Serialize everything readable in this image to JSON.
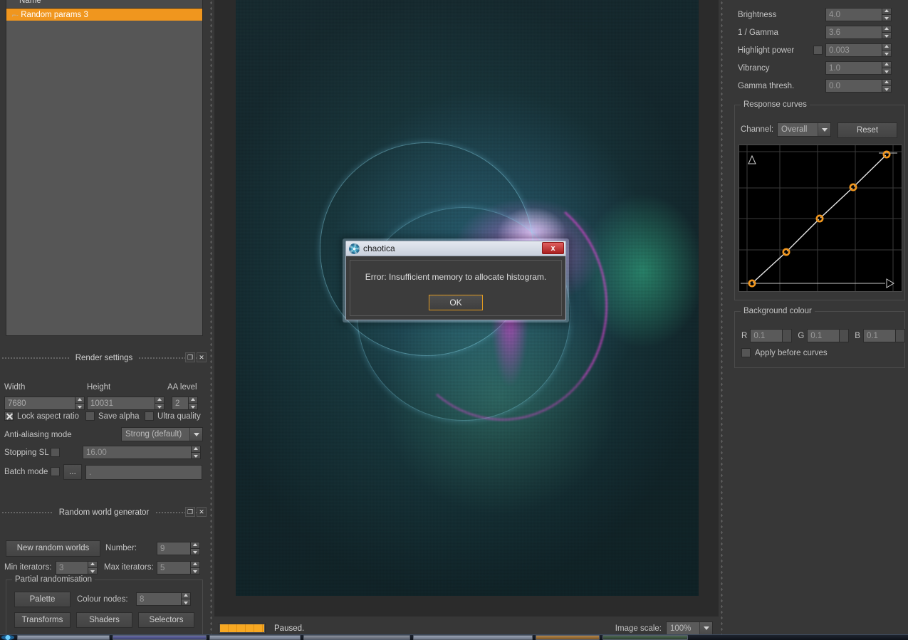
{
  "world_list": {
    "header": "Name",
    "items": [
      {
        "label": "Random params 3",
        "selected": true
      }
    ]
  },
  "render_settings": {
    "title": "Render settings",
    "float_icon": "restore-icon",
    "close_icon": "close-icon",
    "width_label": "Width",
    "width_value": "7680",
    "height_label": "Height",
    "height_value": "10031",
    "aa_level_label": "AA level",
    "aa_level_value": "2",
    "lock_aspect_label": "Lock aspect ratio",
    "lock_aspect_checked": true,
    "save_alpha_label": "Save alpha",
    "save_alpha_checked": false,
    "ultra_quality_label": "Ultra quality",
    "ultra_quality_checked": false,
    "aa_mode_label": "Anti-aliasing mode",
    "aa_mode_value": "Strong (default)",
    "stopping_sl_label": "Stopping SL",
    "stopping_sl_checked": false,
    "stopping_sl_value": "16.00",
    "batch_mode_label": "Batch mode",
    "batch_mode_checked": false,
    "batch_browse_label": "...",
    "batch_path_value": "."
  },
  "random_world_generator": {
    "title": "Random world generator",
    "new_worlds_label": "New random worlds",
    "number_label": "Number:",
    "number_value": "9",
    "min_iterators_label": "Min iterators:",
    "min_iterators_value": "3",
    "max_iterators_label": "Max iterators:",
    "max_iterators_value": "5",
    "partial_randomisation": {
      "title": "Partial randomisation",
      "palette_label": "Palette",
      "colour_nodes_label": "Colour nodes:",
      "colour_nodes_value": "8",
      "transforms_label": "Transforms",
      "shaders_label": "Shaders",
      "selectors_label": "Selectors"
    }
  },
  "image_settings": {
    "brightness_label": "Brightness",
    "brightness_value": "4.0",
    "inv_gamma_label": "1 / Gamma",
    "inv_gamma_value": "3.6",
    "highlight_power_label": "Highlight power",
    "highlight_power_checked": false,
    "highlight_power_value": "0.003",
    "vibrancy_label": "Vibrancy",
    "vibrancy_value": "1.0",
    "gamma_thresh_label": "Gamma thresh.",
    "gamma_thresh_value": "0.0"
  },
  "response_curves": {
    "title": "Response curves",
    "channel_label": "Channel:",
    "channel_value": "Overall",
    "reset_label": "Reset",
    "node_color": "#f0961e",
    "curve_color": "#e6e6e6"
  },
  "background_colour": {
    "title": "Background colour",
    "r_label": "R",
    "r_value": "0.1",
    "g_label": "G",
    "g_value": "0.1",
    "b_label": "B",
    "b_value": "0.1",
    "apply_before_curves_label": "Apply before curves",
    "apply_before_curves_checked": false
  },
  "status_bar": {
    "status_text": "Paused.",
    "progress_color": "#f7a822",
    "image_scale_label": "Image scale:",
    "image_scale_value": "100%"
  },
  "dialog": {
    "title": "chaotica",
    "icon": "chaotica-icon",
    "close_label": "x",
    "message": "Error: Insufficient memory to allocate histogram.",
    "ok_label": "OK",
    "ok_border_color": "#e09a20"
  },
  "chart_data": {
    "type": "line",
    "title": "Response curves",
    "xlabel": "",
    "ylabel": "",
    "xlim": [
      0,
      1
    ],
    "ylim": [
      0,
      1
    ],
    "grid": true,
    "series": [
      {
        "name": "Overall",
        "x": [
          0.0,
          0.25,
          0.5,
          0.75,
          1.0
        ],
        "y": [
          0.0,
          0.25,
          0.5,
          0.75,
          1.0
        ]
      }
    ]
  }
}
